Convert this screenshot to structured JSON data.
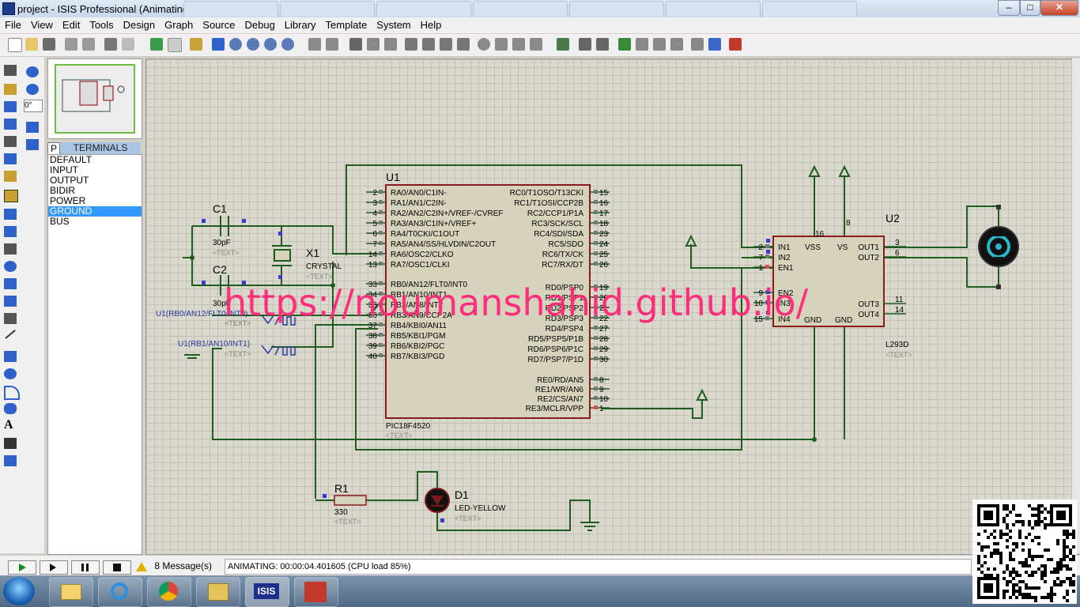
{
  "window": {
    "title": "project - ISIS Professional (Animating)",
    "minimize": "–",
    "maximize": "□",
    "close": "✕"
  },
  "menu": [
    "File",
    "View",
    "Edit",
    "Tools",
    "Design",
    "Graph",
    "Source",
    "Debug",
    "Library",
    "Template",
    "System",
    "Help"
  ],
  "lefttools": {
    "rotation": "0°"
  },
  "device_list": {
    "p_button": "P",
    "header": "TERMINALS",
    "items": [
      "DEFAULT",
      "INPUT",
      "OUTPUT",
      "BIDIR",
      "POWER",
      "GROUND",
      "BUS"
    ],
    "selected": "GROUND"
  },
  "schematic": {
    "u1": {
      "ref": "U1",
      "part": "PIC18F4520",
      "text": "<TEXT>",
      "left_pins": [
        {
          "num": "2",
          "name": "RA0/AN0/C1IN-"
        },
        {
          "num": "3",
          "name": "RA1/AN1/C2IN-"
        },
        {
          "num": "4",
          "name": "RA2/AN2/C2IN+/VREF-/CVREF"
        },
        {
          "num": "5",
          "name": "RA3/AN3/C1IN+/VREF+"
        },
        {
          "num": "6",
          "name": "RA4/T0CKI/C1OUT"
        },
        {
          "num": "7",
          "name": "RA5/AN4/SS/HLVDIN/C2OUT"
        },
        {
          "num": "14",
          "name": "RA6/OSC2/CLKO"
        },
        {
          "num": "13",
          "name": "RA7/OSC1/CLKI"
        },
        {
          "num": "33",
          "name": "RB0/AN12/FLT0/INT0"
        },
        {
          "num": "34",
          "name": "RB1/AN10/INT1"
        },
        {
          "num": "35",
          "name": "RB2/AN8/INT2"
        },
        {
          "num": "36",
          "name": "RB3/AN9/CCP2A"
        },
        {
          "num": "37",
          "name": "RB4/KBI0/AN11"
        },
        {
          "num": "38",
          "name": "RB5/KBI1/PGM"
        },
        {
          "num": "39",
          "name": "RB6/KBI2/PGC"
        },
        {
          "num": "40",
          "name": "RB7/KBI3/PGD"
        }
      ],
      "right_pins": [
        {
          "num": "15",
          "name": "RC0/T1OSO/T13CKI"
        },
        {
          "num": "16",
          "name": "RC1/T1OSI/CCP2B"
        },
        {
          "num": "17",
          "name": "RC2/CCP1/P1A"
        },
        {
          "num": "18",
          "name": "RC3/SCK/SCL"
        },
        {
          "num": "23",
          "name": "RC4/SDI/SDA"
        },
        {
          "num": "24",
          "name": "RC5/SDO"
        },
        {
          "num": "25",
          "name": "RC6/TX/CK"
        },
        {
          "num": "26",
          "name": "RC7/RX/DT"
        },
        {
          "num": "19",
          "name": "RD0/PSP0"
        },
        {
          "num": "20",
          "name": "RD1/PSP1"
        },
        {
          "num": "21",
          "name": "RD2/PSP2"
        },
        {
          "num": "22",
          "name": "RD3/PSP3"
        },
        {
          "num": "27",
          "name": "RD4/PSP4"
        },
        {
          "num": "28",
          "name": "RD5/PSP5/P1B"
        },
        {
          "num": "29",
          "name": "RD6/PSP6/P1C"
        },
        {
          "num": "30",
          "name": "RD7/PSP7/P1D"
        },
        {
          "num": "8",
          "name": "RE0/RD/AN5"
        },
        {
          "num": "9",
          "name": "RE1/WR/AN6"
        },
        {
          "num": "10",
          "name": "RE2/CS/AN7"
        },
        {
          "num": "1",
          "name": "RE3/MCLR/VPP"
        }
      ]
    },
    "u2": {
      "ref": "U2",
      "part": "L293D",
      "text": "<TEXT>",
      "pins_left": [
        {
          "num": "2",
          "name": "IN1"
        },
        {
          "num": "7",
          "name": "IN2"
        },
        {
          "num": "1",
          "name": "EN1"
        },
        {
          "num": "9",
          "name": "EN2"
        },
        {
          "num": "10",
          "name": "IN3"
        },
        {
          "num": "15",
          "name": "IN4"
        }
      ],
      "pins_right": [
        {
          "num": "3",
          "name": "OUT1"
        },
        {
          "num": "6",
          "name": "OUT2"
        },
        {
          "num": "11",
          "name": "OUT3"
        },
        {
          "num": "14",
          "name": "OUT4"
        }
      ],
      "pins_top": [
        {
          "num": "16",
          "name": "VSS"
        },
        {
          "num": "8",
          "name": "VS"
        }
      ],
      "gnd": [
        "GND",
        "GND"
      ]
    },
    "c1": {
      "ref": "C1",
      "value": "30pF",
      "text": "<TEXT>"
    },
    "c2": {
      "ref": "C2",
      "value": "30pF",
      "text": "<TEXT>"
    },
    "x1": {
      "ref": "X1",
      "value": "CRYSTAL",
      "text": "<TEXT>"
    },
    "r1": {
      "ref": "R1",
      "value": "330",
      "text": "<TEXT>"
    },
    "d1": {
      "ref": "D1",
      "value": "LED-YELLOW",
      "text": "<TEXT>"
    },
    "gen1": {
      "label": "U1(RB0/AN12/FLT0/INT0)",
      "text": "<TEXT>"
    },
    "gen2": {
      "label": "U1(RB1/AN10/INT1)",
      "text": "<TEXT>"
    },
    "watermark": "https://noumanshahid.github.io/"
  },
  "status": {
    "messages": "8 Message(s)",
    "animating": "ANIMATING: 00:00:04.401605 (CPU load 85%)"
  },
  "taskbar": {
    "isis_label": "ISIS"
  },
  "colors": {
    "wire": "#1f5d1f",
    "component_fill": "#d6d3bd",
    "component_stroke": "#8b1a1a",
    "watermark": "#ff2d7a"
  }
}
